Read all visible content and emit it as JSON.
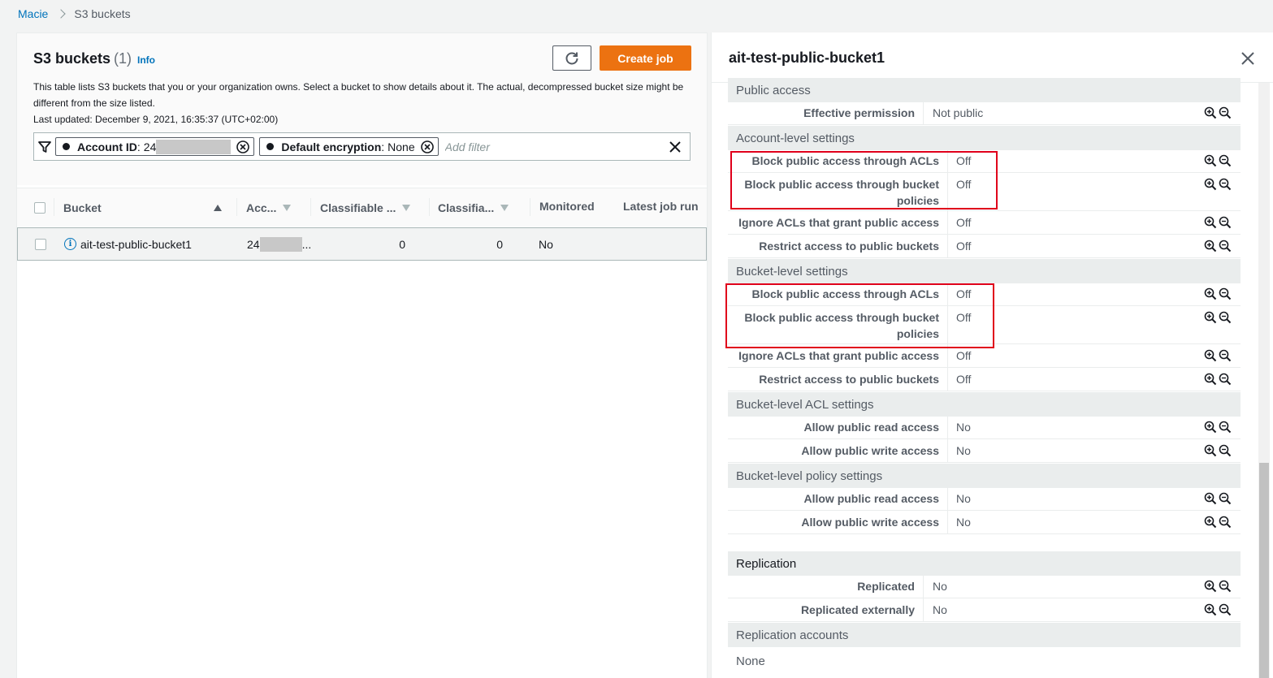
{
  "breadcrumb": {
    "root": "Macie",
    "current": "S3 buckets"
  },
  "list_panel": {
    "title": "S3 buckets",
    "count": "(1)",
    "info_link": "Info",
    "create_job_label": "Create job",
    "description": "This table lists S3 buckets that you or your organization owns. Select a bucket to show details about it. The actual, decompressed bucket size might be different from the size listed.",
    "last_updated": "Last updated: December 9, 2021, 16:35:37 (UTC+02:00)",
    "filters": [
      {
        "key": "Account ID",
        "value": "24"
      },
      {
        "key": "Default encryption",
        "value": "None"
      }
    ],
    "add_filter_placeholder": "Add filter",
    "columns": [
      "Bucket",
      "Acc...",
      "Classifiable ...",
      "Classifia...",
      "Monitored",
      "Latest job run"
    ],
    "rows": [
      {
        "bucket": "ait-test-public-bucket1",
        "account": "24",
        "account_suffix": "...",
        "classifiable_objects": "0",
        "classifiable_size": "0",
        "monitored": "No"
      }
    ]
  },
  "detail_panel": {
    "title": "ait-test-public-bucket1",
    "sections": {
      "public_access": {
        "title": "Public access",
        "rows": [
          {
            "key": "Effective permission",
            "value": "Not public"
          }
        ]
      },
      "account_level": {
        "title": "Account-level settings",
        "rows": [
          {
            "key": "Block public access through ACLs",
            "value": "Off"
          },
          {
            "key": "Block public access through bucket policies",
            "value": "Off"
          },
          {
            "key": "Ignore ACLs that grant public access",
            "value": "Off"
          },
          {
            "key": "Restrict access to public buckets",
            "value": "Off"
          }
        ]
      },
      "bucket_level": {
        "title": "Bucket-level settings",
        "rows": [
          {
            "key": "Block public access through ACLs",
            "value": "Off"
          },
          {
            "key": "Block public access through bucket policies",
            "value": "Off"
          },
          {
            "key": "Ignore ACLs that grant public access",
            "value": "Off"
          },
          {
            "key": "Restrict access to public buckets",
            "value": "Off"
          }
        ]
      },
      "bucket_acl": {
        "title": "Bucket-level ACL settings",
        "rows": [
          {
            "key": "Allow public read access",
            "value": "No"
          },
          {
            "key": "Allow public write access",
            "value": "No"
          }
        ]
      },
      "bucket_policy": {
        "title": "Bucket-level policy settings",
        "rows": [
          {
            "key": "Allow public read access",
            "value": "No"
          },
          {
            "key": "Allow public write access",
            "value": "No"
          }
        ]
      },
      "replication": {
        "title": "Replication",
        "rows": [
          {
            "key": "Replicated",
            "value": "No"
          },
          {
            "key": "Replicated externally",
            "value": "No"
          }
        ]
      },
      "replication_accounts": {
        "title": "Replication accounts",
        "value": "None"
      }
    }
  },
  "colors": {
    "accent": "#ec7211",
    "link": "#0073bb",
    "highlight": "#e0001b"
  }
}
